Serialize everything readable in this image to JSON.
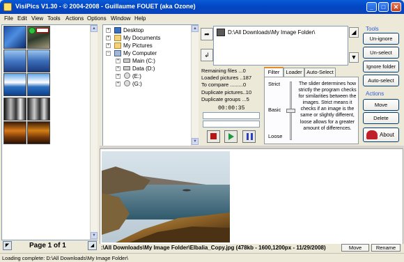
{
  "window": {
    "title": "VisiPics V1.30 - © 2004-2008 - Guillaume FOUET (aka Ozone)",
    "minimize": "_",
    "maximize": "□",
    "close": "✕"
  },
  "menu": [
    "File",
    "Edit",
    "View",
    "Tools",
    "Actions",
    "Options",
    "Window",
    "Help"
  ],
  "thumbnails": {
    "page_label": "Page 1 of 1"
  },
  "tree": {
    "items": [
      {
        "label": "Desktop",
        "icon": "desktop-icon"
      },
      {
        "label": "My Documents",
        "icon": "folder-icon"
      },
      {
        "label": "My Pictures",
        "icon": "folder-icon"
      },
      {
        "label": "My Computer",
        "icon": "computer-icon"
      },
      {
        "label": "Main (C:)",
        "icon": "drive-icon"
      },
      {
        "label": "Data (D:)",
        "icon": "drive-icon"
      },
      {
        "label": "(E:)",
        "icon": "cdrom-icon"
      },
      {
        "label": "(G:)",
        "icon": "cdrom-icon"
      }
    ]
  },
  "folders": {
    "selected_path": "D:\\All Downloads\\My Image Folder\\"
  },
  "stats": {
    "remaining": "Remaining files ...0",
    "loaded": "Loaded pictures ..187",
    "to_compare": "To compare .........0",
    "duplicate_pictures": "Duplicate pictures..10",
    "duplicate_groups": "Duplicate groups ...5",
    "timer": "00:00:35"
  },
  "tabs": {
    "filter": "Filter",
    "loader": "Loader",
    "auto_select": "Auto-Select"
  },
  "filter": {
    "strict": "Strict",
    "basic": "Basic",
    "loose": "Loose",
    "slider_value": 0.5,
    "help": "The slider determines how strictly the program checks for similarities between the images. Strict means it checks if an image is the same or slightly different, loose allows for a greater amount of differences."
  },
  "tools": {
    "heading": "Tools",
    "unignore": "Un-ignore",
    "unselect": "Un-select",
    "ignore_folder": "Ignore folder",
    "auto_select": "Auto-select"
  },
  "actions": {
    "heading": "Actions",
    "move": "Move",
    "delete": "Delete",
    "about": "About"
  },
  "preview": {
    "info": ":\\All Downloads\\My Image Folder\\Elbalia_Copy.jpg (478kb - 1600,1200px - 11/29/2008)",
    "move": "Move",
    "rename": "Rename"
  },
  "status": {
    "text": "Loading complete: D:\\All Downloads\\My Image Folder\\"
  }
}
